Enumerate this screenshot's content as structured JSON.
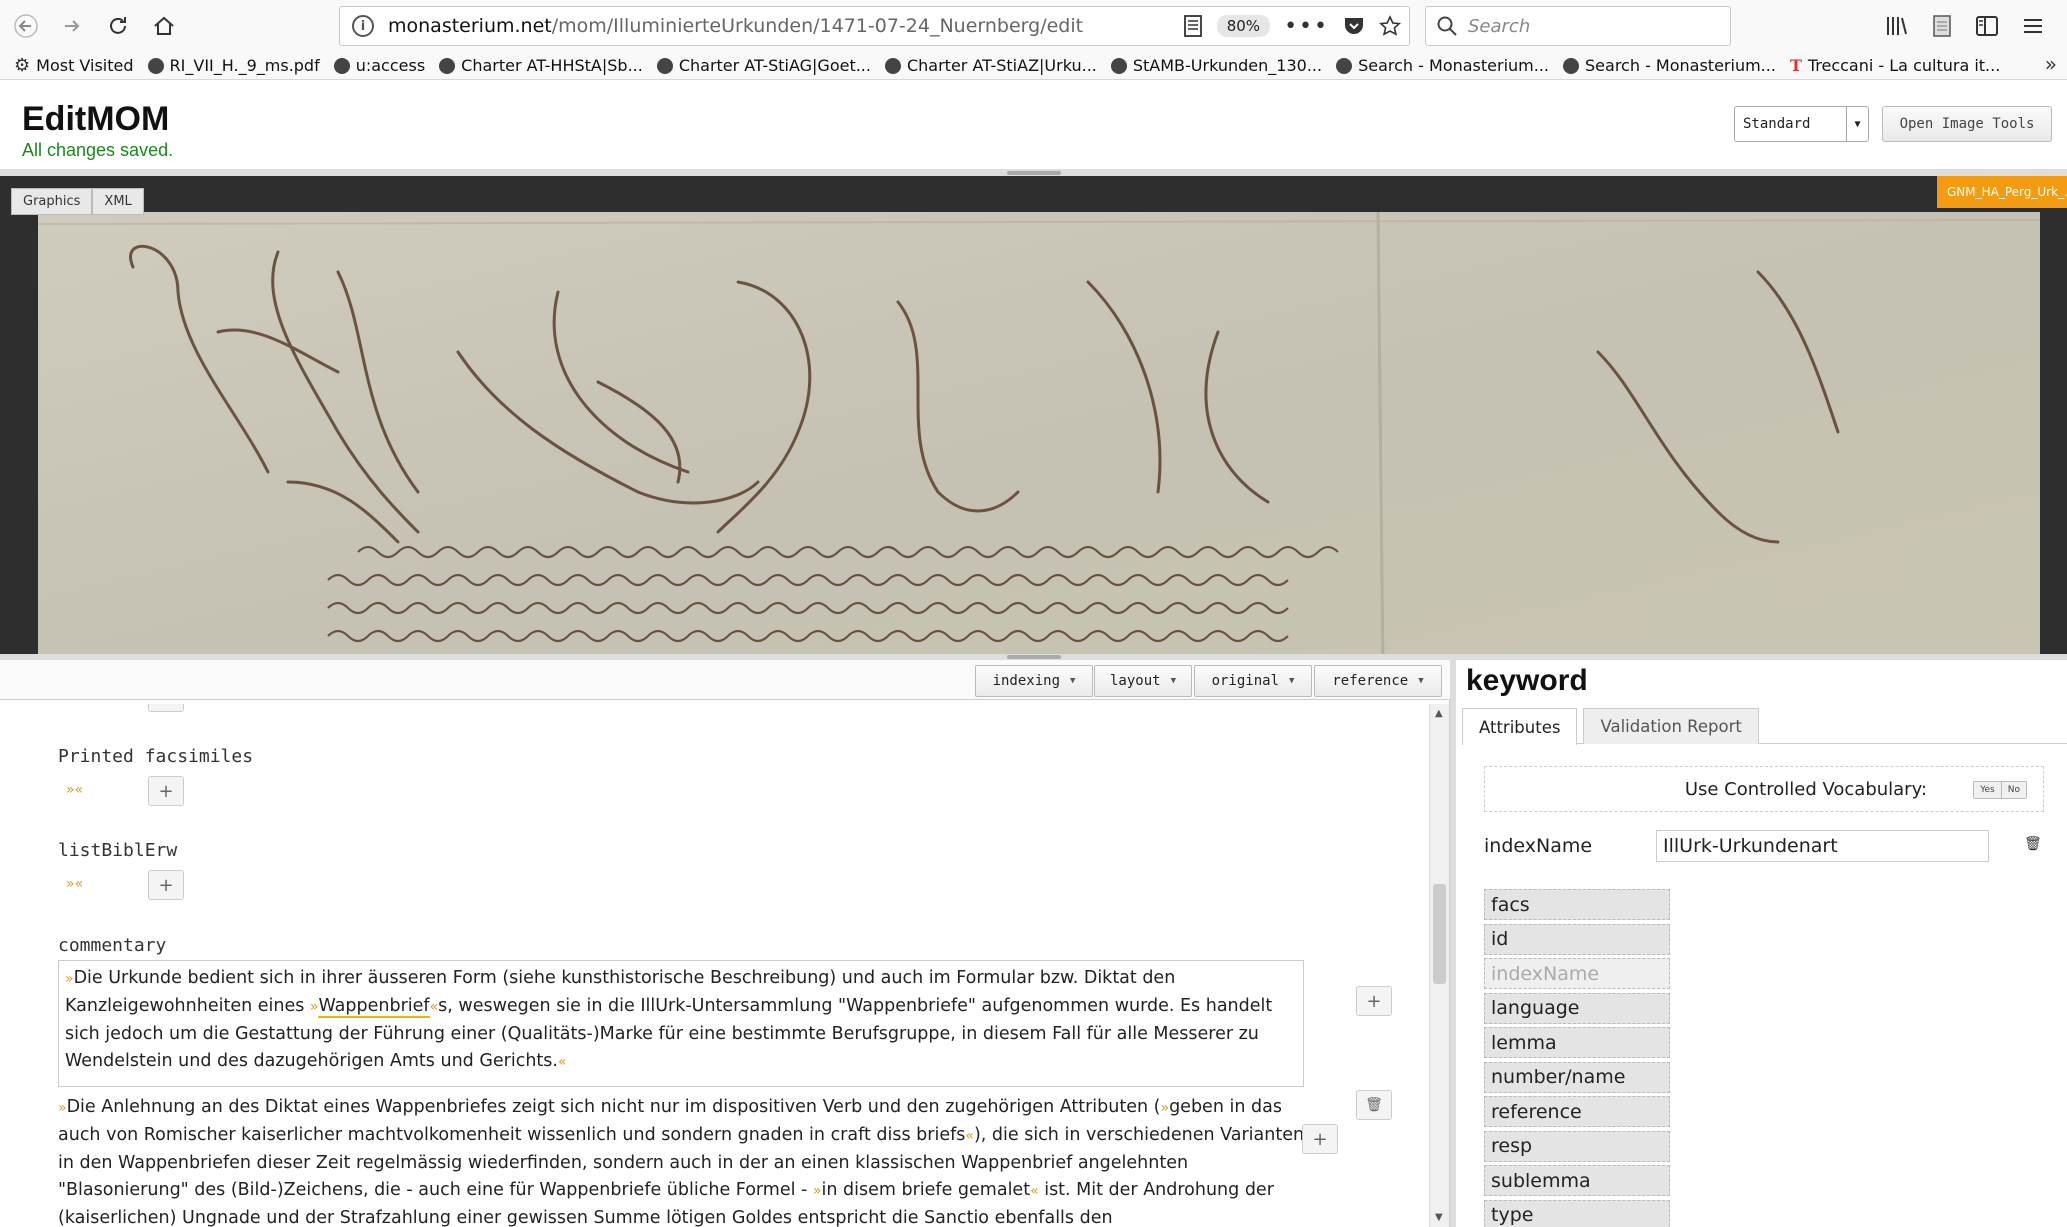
{
  "browser": {
    "url_host": "monasterium.net",
    "url_path": "/mom/IlluminierteUrkunden/1471-07-24_Nuernberg/edit",
    "zoom": "80%",
    "search_placeholder": "Search",
    "bookmarks": [
      {
        "label": "Most Visited",
        "icon": "gear-icon"
      },
      {
        "label": "RI_VII_H._9_ms.pdf",
        "icon": "globe-icon"
      },
      {
        "label": "u:access",
        "icon": "globe-icon"
      },
      {
        "label": "Charter AT-HHStA|Sb...",
        "icon": "globe-icon"
      },
      {
        "label": "Charter AT-StiAG|Goet...",
        "icon": "globe-icon"
      },
      {
        "label": "Charter AT-StiAZ|Urku...",
        "icon": "globe-icon"
      },
      {
        "label": "StAMB-Urkunden_130...",
        "icon": "globe-icon"
      },
      {
        "label": "Search - Monasterium...",
        "icon": "globe-icon"
      },
      {
        "label": "Search - Monasterium...",
        "icon": "globe-icon"
      },
      {
        "label": "Treccani - La cultura it...",
        "icon": "treccani-icon"
      }
    ]
  },
  "app": {
    "title": "EditMOM",
    "save_status": "All changes saved.",
    "view_select": "Standard",
    "open_image_tools": "Open Image Tools"
  },
  "viewer": {
    "tabs": [
      "Graphics",
      "XML"
    ],
    "filename": "GNM_HA_Perg_Urk_.jpg"
  },
  "editor": {
    "mode_buttons": [
      "indexing",
      "layout",
      "original",
      "reference"
    ],
    "fields": {
      "printed_facsimiles": "Printed facsimiles",
      "list_bibl_erw": "listBiblErw",
      "commentary": "commentary",
      "empty_marker": "»«"
    },
    "commentary_1": {
      "before": "Die Urkunde bedient sich in ihrer äusseren Form (siehe kunsthistorische Beschreibung) und auch im Formular bzw. Diktat den Kanzleigewohnheiten eines ",
      "term": "Wappenbrief",
      "after": "s, weswegen sie in die IllUrk-Untersammlung \"Wappenbriefe\" aufgenommen wurde. Es handelt sich jedoch um die Gestattung der Führung einer (Qualitäts-)Marke für eine bestimmte Berufsgruppe, in diesem Fall für alle Messerer zu Wendelstein und des dazugehörigen Amts und Gerichts."
    },
    "commentary_2": {
      "part1": "Die Anlehnung an des Diktat eines Wappenbriefes zeigt sich nicht nur im dispositiven Verb und den zugehörigen Attributen (",
      "quote1": "geben in das auch von Romischer kaiserlicher machtvolkomenheit wissenlich und sondern gnaden in craft diss briefs",
      "part2": "), die sich in verschiedenen Varianten in den Wappenbriefen dieser Zeit regelmässig wiederfinden, sondern auch in der an einen klassischen Wappenbrief angelehnten \"Blasonierung\" des (Bild-)Zeichens, die - auch eine für Wappenbriefe übliche Formel - ",
      "quote2": "in disem briefe gemalet",
      "part3": " ist. Mit der Androhung der (kaiserlichen) Ungnade und der Strafzahlung einer gewissen Summe lötigen Goldes entspricht die Sanctio ebenfalls den"
    }
  },
  "side_panel": {
    "title": "keyword",
    "tabs": [
      "Attributes",
      "Validation Report"
    ],
    "vocab_label": "Use Controlled Vocabulary:",
    "vocab_yes": "Yes",
    "vocab_no": "No",
    "indexname_label": "indexName",
    "indexname_value": "IllUrk-Urkundenart",
    "attributes": [
      "facs",
      "id",
      "indexName",
      "language",
      "lemma",
      "number/name",
      "reference",
      "resp",
      "sublemma",
      "type"
    ],
    "disabled_attribute": "indexName"
  },
  "colors": {
    "save_status": "#1a8a1a",
    "filename_badge": "#f39c12",
    "quote_marker": "#d4a017",
    "viewer_bg": "#2e2e2e",
    "parchment": "#c9c5b6",
    "ink": "#5a3f2c"
  }
}
